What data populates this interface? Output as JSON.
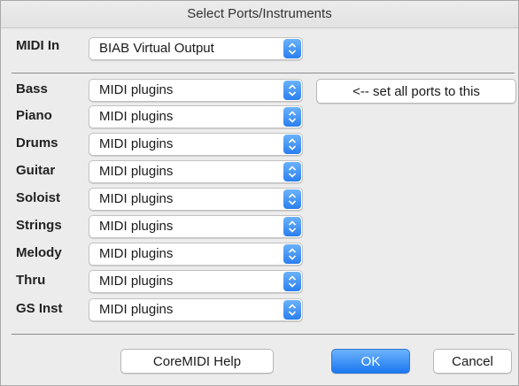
{
  "window": {
    "title": "Select Ports/Instruments"
  },
  "midi_in": {
    "label": "MIDI In",
    "value": "BIAB Virtual Output"
  },
  "instruments": [
    {
      "label": "Bass",
      "port": "MIDI plugins"
    },
    {
      "label": "Piano",
      "port": "MIDI plugins"
    },
    {
      "label": "Drums",
      "port": "MIDI plugins"
    },
    {
      "label": "Guitar",
      "port": "MIDI plugins"
    },
    {
      "label": "Soloist",
      "port": "MIDI plugins"
    },
    {
      "label": "Strings",
      "port": "MIDI plugins"
    },
    {
      "label": "Melody",
      "port": "MIDI plugins"
    },
    {
      "label": "Thru",
      "port": "MIDI plugins"
    },
    {
      "label": "GS Inst",
      "port": "MIDI plugins"
    }
  ],
  "buttons": {
    "set_all": "<-- set all ports to this",
    "help": "CoreMIDI Help",
    "ok": "OK",
    "cancel": "Cancel"
  },
  "colors": {
    "accent": "#2a7ff0",
    "background": "#ececec"
  },
  "icons": {
    "popup": "up-down-chevron-icon"
  }
}
